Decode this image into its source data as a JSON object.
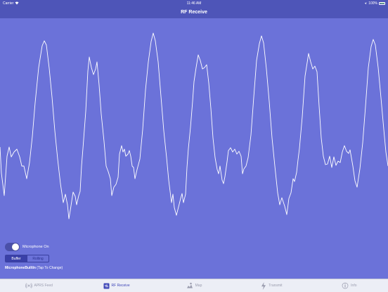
{
  "status": {
    "carrier": "Carrier",
    "time": "11:46 AM",
    "battery": "100%"
  },
  "nav": {
    "title": "RF Receive"
  },
  "controls": {
    "mic_label": "Microphone On",
    "segments": [
      "Buffer",
      "Rolling"
    ],
    "input_name": "MicrophoneBuiltIn",
    "input_hint": " (Tap To Change)"
  },
  "tabs": [
    {
      "label": "APRS Feed",
      "icon": "antenna-icon"
    },
    {
      "label": "RF Receive",
      "icon": "square-icon"
    },
    {
      "label": "Map",
      "icon": "map-icon"
    },
    {
      "label": "Transmit",
      "icon": "lightning-icon"
    },
    {
      "label": "Info",
      "icon": "info-icon"
    }
  ],
  "colors": {
    "background": "#6b72d9",
    "bar": "#4e55b8",
    "accent": "#4048b8",
    "wave": "#ffffff"
  }
}
